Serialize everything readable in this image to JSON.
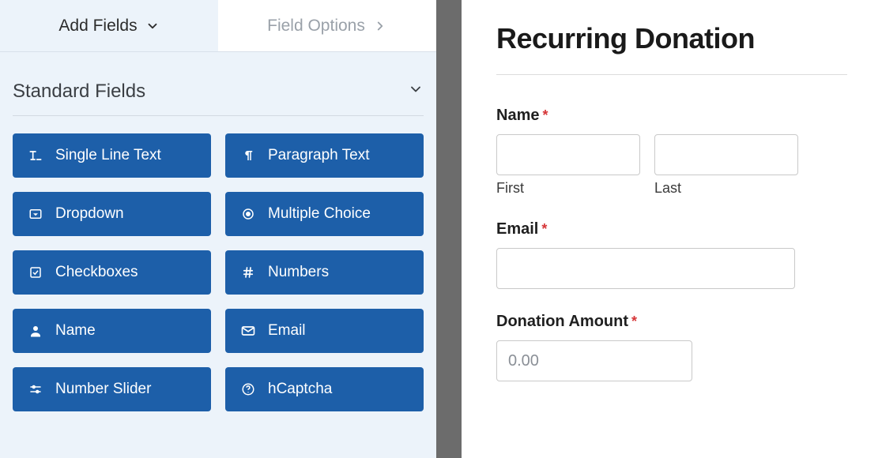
{
  "tabs": {
    "add_fields": "Add Fields",
    "field_options": "Field Options"
  },
  "section": {
    "standard_fields": "Standard Fields"
  },
  "fields": {
    "single_line_text": "Single Line Text",
    "paragraph_text": "Paragraph Text",
    "dropdown": "Dropdown",
    "multiple_choice": "Multiple Choice",
    "checkboxes": "Checkboxes",
    "numbers": "Numbers",
    "name": "Name",
    "email": "Email",
    "number_slider": "Number Slider",
    "hcaptcha": "hCaptcha"
  },
  "form": {
    "title": "Recurring Donation",
    "name_label": "Name",
    "first_sub": "First",
    "last_sub": "Last",
    "email_label": "Email",
    "donation_label": "Donation Amount",
    "donation_placeholder": "0.00",
    "required_mark": "*"
  }
}
